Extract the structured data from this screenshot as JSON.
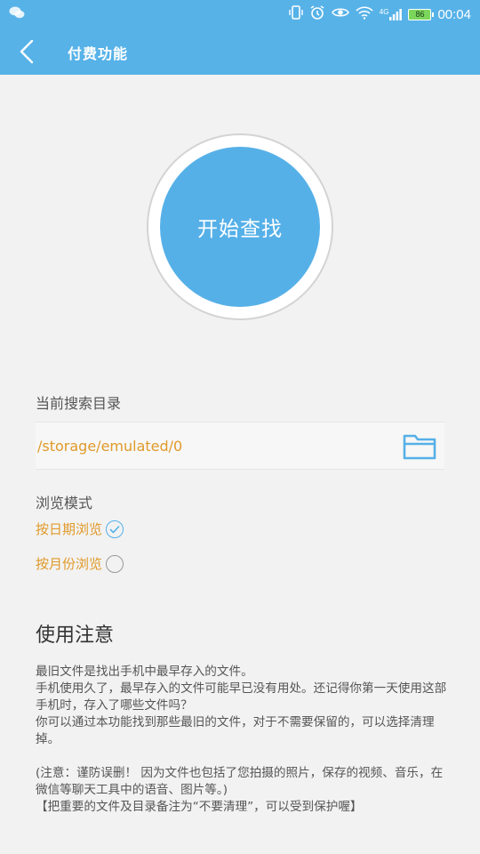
{
  "statusbar": {
    "time": "00:04",
    "battery": "86",
    "network": "4G"
  },
  "appbar": {
    "title": "付费功能"
  },
  "main": {
    "start_button": "开始查找",
    "directory_label": "当前搜索目录",
    "directory_path": "/storage/emulated/0",
    "browse_mode_label": "浏览模式",
    "options": [
      {
        "label": "按日期浏览",
        "selected": true
      },
      {
        "label": "按月份浏览",
        "selected": false
      }
    ]
  },
  "notes": {
    "title": "使用注意",
    "p1": "最旧文件是找出手机中最早存入的文件。",
    "p2": "手机使用久了，最早存入的文件可能早已没有用处。还记得你第一天使用这部手机时，存入了哪些文件吗？",
    "p3": "你可以通过本功能找到那些最旧的文件，对于不需要保留的，可以选择清理掉。",
    "p4": "(注意：谨防误删！ 因为文件也包括了您拍摄的照片，保存的视频、音乐，在微信等聊天工具中的语音、图片等。)",
    "p5": "【把重要的文件及目录备注为“不要清理”，可以受到保护喔】"
  },
  "colors": {
    "primary": "#57b2e8",
    "accent": "#e09a2a"
  }
}
